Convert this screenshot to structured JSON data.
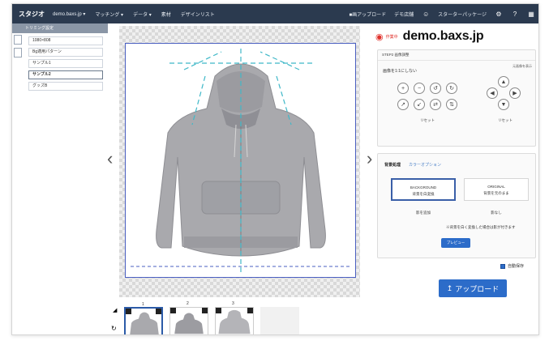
{
  "topbar": {
    "logo": "スタジオ",
    "menu": [
      "demo.baxs.jp ▾",
      "マッチング ▾",
      "データ ▾",
      "素材",
      "デザインリスト"
    ],
    "right": [
      "■画アップロード",
      "デモ店舗",
      "スターターパッケージ"
    ]
  },
  "sidebar": {
    "header": "トリミング設定",
    "items": [
      "1080×808",
      "Bg適用パターン",
      "サンプル1",
      "サンプル2",
      "グッズB"
    ],
    "active_index": 3
  },
  "canvas": {
    "prev_arrow": "‹",
    "next_arrow": "›"
  },
  "thumbnails": {
    "labels": [
      "1",
      "2",
      "3"
    ],
    "selected_index": 0
  },
  "right": {
    "brand_small": "作業中",
    "brand_name": "demo.baxs.jp",
    "panel1": {
      "title": "STEP2 画像調整",
      "subtitle": "画像を1:1にしない",
      "subtitle_right": "元画像を表示",
      "left_caption": "リセット",
      "right_caption": "リセット"
    },
    "panel2": {
      "tab_active": "背景処理",
      "tab_other": "カラーオプション",
      "card1": [
        "BACKGROUND",
        "背景を白変換"
      ],
      "card2": [
        "ORIGINAL",
        "背景を元のまま"
      ],
      "option1": "影を追加",
      "option2": "影なし",
      "note": "※背景を白く変換した場合は影が付きます",
      "preview_label": "プレビュー"
    },
    "checkbox_label": "自動保存",
    "upload_label": "アップロード"
  },
  "colors": {
    "topbar": "#2b3a4f",
    "accent": "#2c6cc9",
    "brand_red": "#e0312b",
    "guide": "#3fb8c8"
  }
}
